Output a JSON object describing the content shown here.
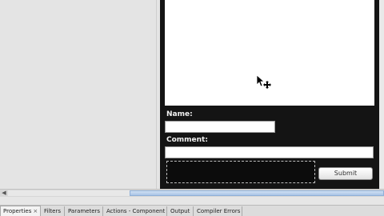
{
  "form": {
    "name_label": "Name:",
    "name_value": "",
    "comment_label": "Comment:",
    "comment_value": "",
    "submit_label": "Submit"
  },
  "bottom_panel": {
    "tabs": [
      {
        "label": "Properties",
        "active": true,
        "closable": true
      },
      {
        "label": "Filters"
      },
      {
        "label": "Parameters"
      },
      {
        "label": "Actions - Component"
      },
      {
        "label": "Output"
      },
      {
        "label": "Compiler Errors"
      }
    ],
    "close_glyph": "×"
  },
  "icons": {
    "cursor": "move-cursor-icon",
    "scroll_left": "scroll-left-arrow-icon"
  },
  "colors": {
    "panel_bg": "#141414",
    "stage_bg": "#e4e4e4",
    "scroll_thumb": "#a9c4e6"
  }
}
